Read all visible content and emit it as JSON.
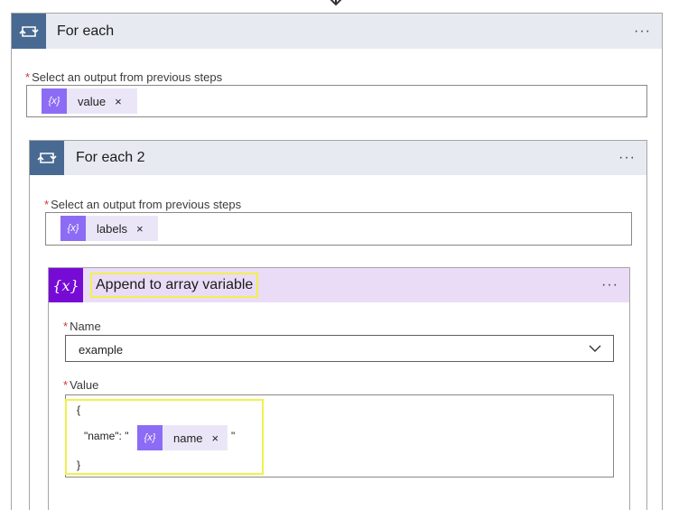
{
  "outer_loop": {
    "title": "For each",
    "ellipsis": "···",
    "field_label": "Select an output from previous steps",
    "required": "*",
    "token": {
      "icon": "{x}",
      "label": "value",
      "close": "×"
    }
  },
  "inner_loop": {
    "title": "For each 2",
    "ellipsis": "···",
    "field_label": "Select an output from previous steps",
    "required": "*",
    "token": {
      "icon": "{x}",
      "label": "labels",
      "close": "×"
    }
  },
  "append_action": {
    "title": "Append to array variable",
    "icon": "{x}",
    "ellipsis": "···",
    "name_label": "Name",
    "name_required": "*",
    "name_value": "example",
    "value_label": "Value",
    "value_required": "*",
    "value_lines": {
      "open_brace": "{",
      "key_prefix": "\"name\": \"",
      "key_suffix": "\"",
      "close_brace": "}"
    },
    "value_token": {
      "icon": "{x}",
      "label": "name",
      "close": "×"
    }
  },
  "colors": {
    "loop_header_bg": "#e7eaf1",
    "loop_icon_bg": "#486991",
    "variable_header_bg": "#eadcf6",
    "variable_icon_bg": "#770bd6",
    "token_bg": "#ebe6f7",
    "token_icon_bg": "#8c6cf5",
    "highlight": "#f1f14b",
    "required": "#d13438"
  }
}
